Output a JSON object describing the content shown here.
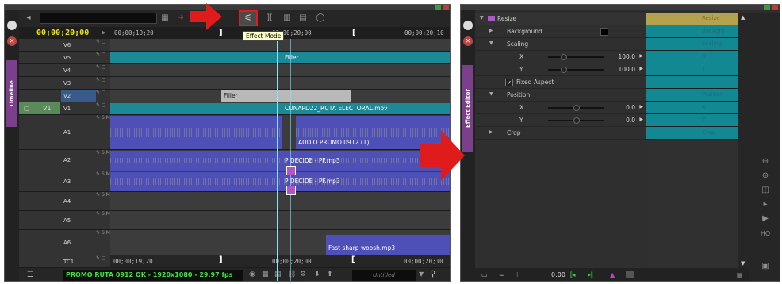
{
  "timeline": {
    "toolbar": {
      "effect_mode_icon": "effect-mode-icon",
      "tooltip": "Effect Mode"
    },
    "current_timecode": "00;00;20;00",
    "ruler": {
      "left": "00;00;19;20",
      "center": "00;00;20;00",
      "right": "00;00;20;10"
    },
    "bottom_ruler": {
      "left": "00;00;19;20",
      "center": "00;00;20;00",
      "right": "00;00;20;10"
    },
    "side_tab": "Timeline",
    "tracks": [
      {
        "name": "V6"
      },
      {
        "name": "V5"
      },
      {
        "name": "V4"
      },
      {
        "name": "V3"
      },
      {
        "name": "V2"
      },
      {
        "name": "V1",
        "source": "V1"
      },
      {
        "name": "A1"
      },
      {
        "name": "A2"
      },
      {
        "name": "A3"
      },
      {
        "name": "A4"
      },
      {
        "name": "A5"
      },
      {
        "name": "A6"
      },
      {
        "name": "TC1"
      }
    ],
    "track_flags": [
      "S",
      "M"
    ],
    "clips": {
      "v5": "Filler",
      "v2": "Filler",
      "v1": "CUNAPD22_RUTA ELECTORAL.mov",
      "a1": "AUDIO PROMO 0912 (1)",
      "a2": "P DECIDE - PF.mp3",
      "a3": "P DECIDE - PF.mp3",
      "a6": "Fast sharp woosh.mp3"
    },
    "sequence_name": "PROMO RUTA 0912 OK - 1920x1080 - 29.97 fps",
    "untitled": "Untitled"
  },
  "effect_editor": {
    "side_tab": "Effect Editor",
    "effect_name": "Resize",
    "keyframe_header": "Resize",
    "params": [
      {
        "label": "Background"
      },
      {
        "label": "Scaling"
      },
      {
        "label": "X",
        "value": "100.0"
      },
      {
        "label": "Y",
        "value": "100.0"
      },
      {
        "label": "Fixed Aspect"
      },
      {
        "label": "Position"
      },
      {
        "label": "X",
        "value": "0.0"
      },
      {
        "label": "Y",
        "value": "0.0"
      },
      {
        "label": "Crop"
      }
    ],
    "kf_labels": [
      "Backgro",
      "Scaling",
      "X",
      "Y",
      "Position",
      "X",
      "Y",
      "Crop"
    ],
    "status_time": "0:00",
    "right_panel": {
      "hq_label": "HQ"
    }
  },
  "colors": {
    "accent_red": "#e01b1b",
    "video_clip": "#1c8a96",
    "audio_clip": "#4f4fb8",
    "timecode_yellow": "#e6e600",
    "sequence_green": "#40e040",
    "tab_purple": "#7b3f8c",
    "keyframe_header": "#b5a24f"
  }
}
